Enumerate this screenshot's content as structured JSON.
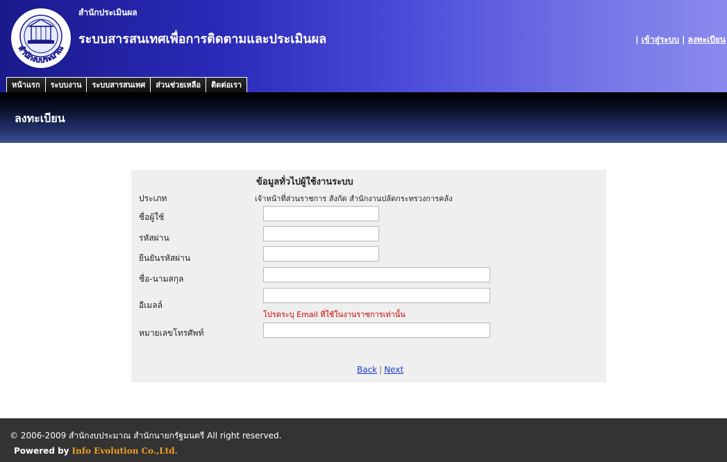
{
  "header": {
    "org_name": "สำนักประเมินผล",
    "system_title": "ระบบสารสนเทศเพื่อการติดตามและประเมินผล",
    "links": {
      "login": "เข้าสู่ระบบ",
      "register": "ลงทะเบียน",
      "separator": "|"
    }
  },
  "menu": {
    "items": [
      {
        "label": "หน้าแรก"
      },
      {
        "label": "ระบบงาน"
      },
      {
        "label": "ระบบสารสนเทศ"
      },
      {
        "label": "ส่วนช่วยเหลือ"
      },
      {
        "label": "ติดต่อเรา"
      }
    ]
  },
  "page": {
    "heading": "ลงทะเบียน"
  },
  "form": {
    "heading": "ข้อมูลทั่วไปผู้ใช้งานระบบ",
    "type_label": "ประเภท",
    "type_value": "เจ้าหน้าที่ส่วนราชการ สังกัด สำนักงานปลัดกระทรวงการคลัง",
    "fields": {
      "username": {
        "label": "ชื่อผู้ใช้",
        "value": ""
      },
      "password": {
        "label": "รหัสผ่าน",
        "value": ""
      },
      "confirm_password": {
        "label": "ยืนยันรหัสผ่าน",
        "value": ""
      },
      "fullname": {
        "label": "ชื่อ-นามสกุล",
        "value": ""
      },
      "email": {
        "label": "อีเมลล์",
        "value": ""
      },
      "phone": {
        "label": "หมายเลขโทรศัพท์",
        "value": ""
      }
    },
    "email_hint": "โปรดระบุ Email ที่ใช้ในงานราชการเท่านั้น",
    "nav": {
      "back": "Back",
      "next": "Next",
      "separator": "|"
    }
  },
  "footer": {
    "copyright": "© 2006-2009 สำนักงบประมาณ สำนักนายกรัฐมนตรี All right reserved.",
    "powered_label": "Powered by",
    "powered_company": "Info Evolution Co.,Ltd."
  },
  "seal": {
    "ring_text": "สำนักงบประมาณ"
  },
  "colors": {
    "header_start": "#1a1a8c",
    "header_end": "#8a8aee",
    "email_hint": "#cc0000",
    "link": "#1a3cc8",
    "footer_bg": "#333333",
    "powered_company": "#f0a020"
  }
}
